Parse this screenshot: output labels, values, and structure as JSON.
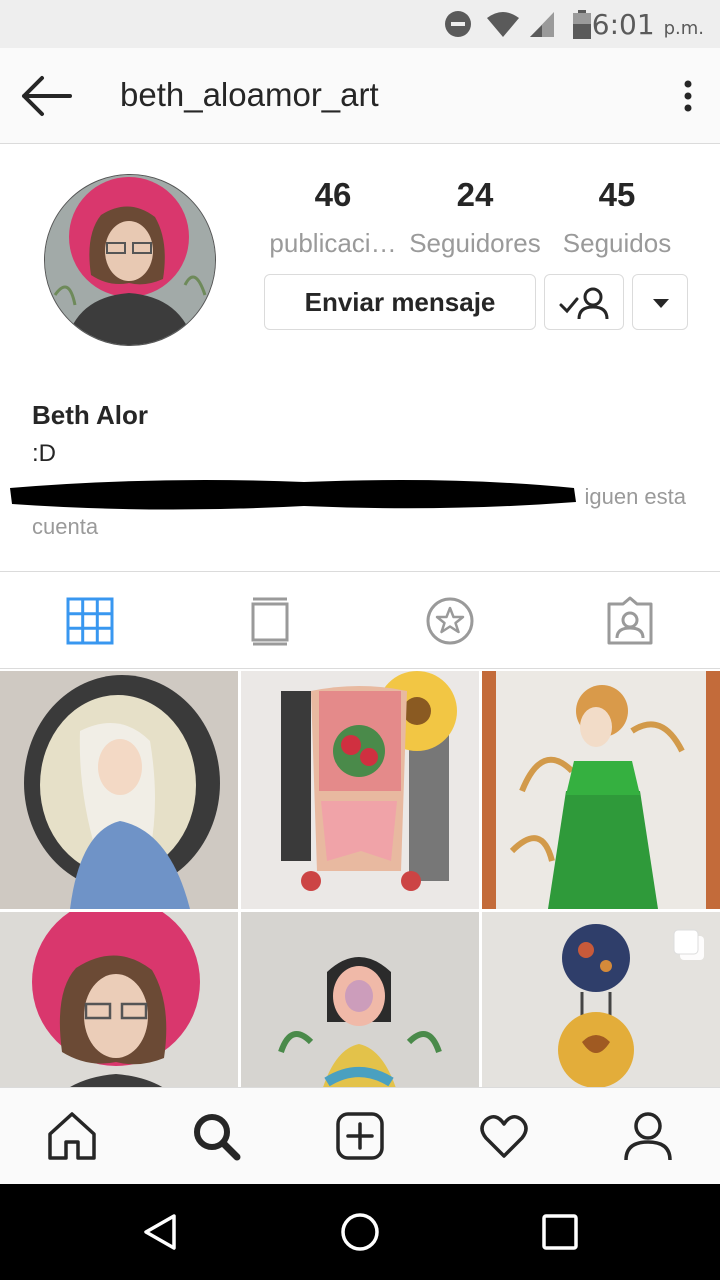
{
  "status_bar": {
    "time": "6:01",
    "ampm": "p.m."
  },
  "header": {
    "username": "beth_aloamor_art"
  },
  "profile": {
    "stats": [
      {
        "count": "46",
        "label": "publicaci…"
      },
      {
        "count": "24",
        "label": "Seguidores"
      },
      {
        "count": "45",
        "label": "Seguidos"
      }
    ],
    "message_button": "Enviar mensaje",
    "name": "Beth Alor",
    "bio": ":D",
    "followed_by_visible_line1": "iguen esta",
    "followed_by_visible_line2": "cuenta"
  },
  "tabs": [
    "grid-icon",
    "feed-icon",
    "saved-star-icon",
    "tagged-icon"
  ],
  "colors": {
    "accent_blue": "#3897f0",
    "text": "#262626",
    "secondary_text": "#9a9a9a",
    "border": "#dbdbdb"
  },
  "bottom_nav": [
    "home-icon",
    "search-icon",
    "add-post-icon",
    "activity-heart-icon",
    "profile-icon"
  ]
}
